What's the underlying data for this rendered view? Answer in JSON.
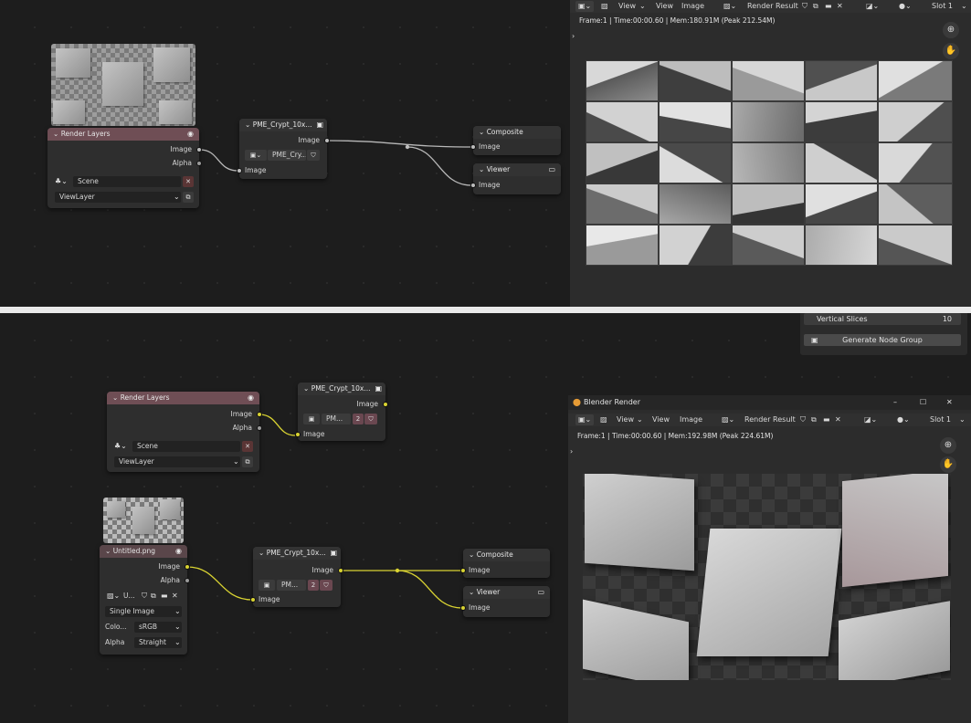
{
  "top": {
    "render_layers_node": {
      "title": "Render Layers",
      "outputs": [
        "Image",
        "Alpha"
      ],
      "scene": "Scene",
      "view_layer": "ViewLayer"
    },
    "crypt_node": {
      "title": "PME_Crypt_10x...",
      "output": "Image",
      "group_name": "PME_Cry...",
      "input": "Image"
    },
    "composite_node": {
      "title": "Composite",
      "input": "Image"
    },
    "viewer_node": {
      "title": "Viewer",
      "input": "Image"
    },
    "image_editor": {
      "menu_view": "View",
      "menu_view2": "View",
      "menu_image": "Image",
      "image_name": "Render Result",
      "slot": "Slot 1",
      "info": "Frame:1 | Time:00:00.60 | Mem:180.91M (Peak 212.54M)"
    }
  },
  "bottom": {
    "n_panel": {
      "vertical_slices_label": "Vertical Slices",
      "vertical_slices_value": "10",
      "generate_button": "Generate Node Group"
    },
    "render_layers_node": {
      "title": "Render Layers",
      "outputs": [
        "Image",
        "Alpha"
      ],
      "scene": "Scene",
      "view_layer": "ViewLayer"
    },
    "crypt_node_a": {
      "title": "PME_Crypt_10x...",
      "output": "Image",
      "group_name": "PM...",
      "users": "2",
      "input": "Image"
    },
    "image_node": {
      "title": "Untitled.png",
      "outputs": [
        "Image",
        "Alpha"
      ],
      "image_short": "U...",
      "source": "Single Image",
      "color_label": "Colo...",
      "color_value": "sRGB",
      "alpha_label": "Alpha",
      "alpha_value": "Straight"
    },
    "crypt_node_b": {
      "title": "PME_Crypt_10x...",
      "output": "Image",
      "group_name": "PM...",
      "users": "2",
      "input": "Image"
    },
    "composite_node": {
      "title": "Composite",
      "input": "Image"
    },
    "viewer_node": {
      "title": "Viewer",
      "input": "Image"
    },
    "render_window": {
      "title": "Blender Render",
      "menu_view": "View",
      "menu_view2": "View",
      "menu_image": "Image",
      "image_name": "Render Result",
      "slot": "Slot 1",
      "info": "Frame:1 | Time:00:00.60 | Mem:192.98M (Peak 224.61M)"
    }
  },
  "icons": [
    "chevron-down-icon",
    "eye-icon",
    "close-icon",
    "monitor-icon",
    "zoom-icon",
    "hand-icon",
    "shield-icon",
    "copy-icon",
    "folder-icon",
    "node-group-icon",
    "image-icon",
    "scene-icon",
    "window-minimize-icon",
    "window-maximize-icon",
    "window-close-icon",
    "blender-logo-icon"
  ],
  "colors": {
    "socket_image": "#d9d332",
    "socket_gray": "#a0a0a0",
    "render_layers_header": "#6f4e55",
    "link_highlight": "#d9d332"
  }
}
